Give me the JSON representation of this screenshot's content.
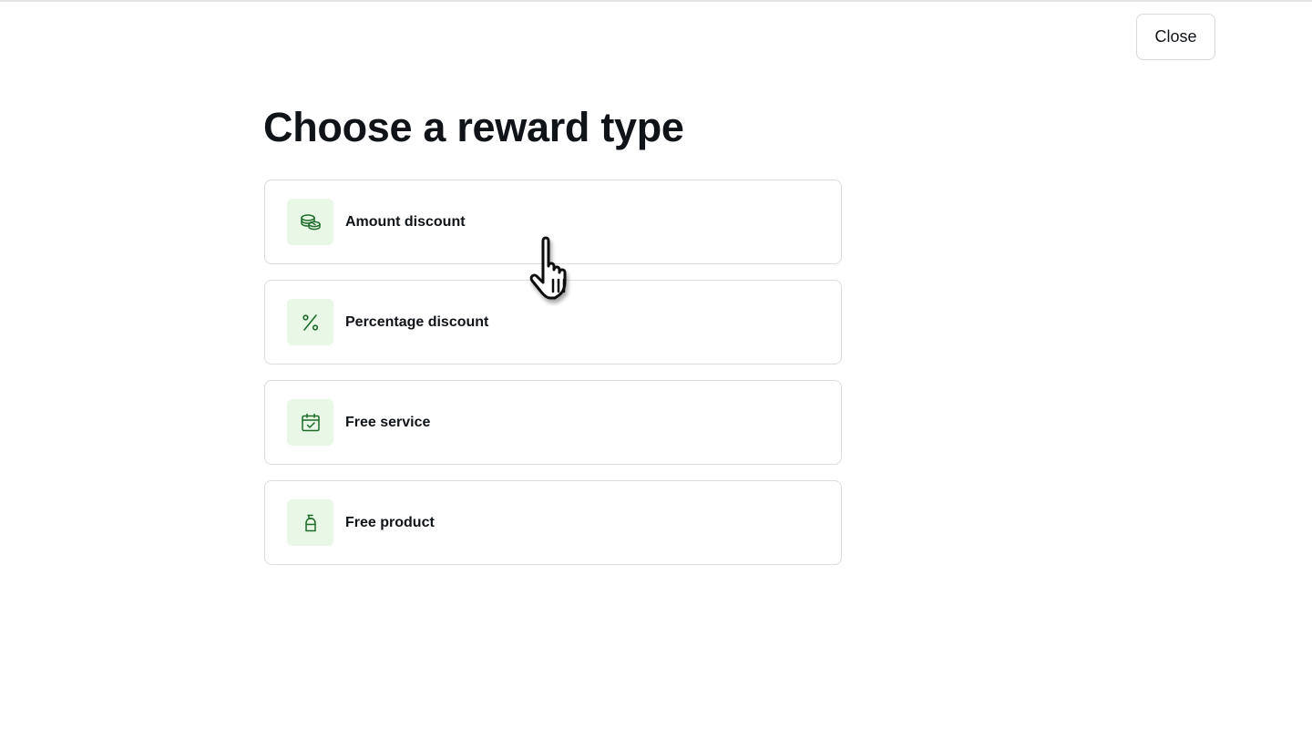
{
  "header": {
    "close_label": "Close"
  },
  "page": {
    "title": "Choose a reward type"
  },
  "colors": {
    "icon_tile_bg": "#e8f7e6",
    "icon_stroke": "#1e6b2a",
    "card_border": "#dcdcdc",
    "text": "#101418"
  },
  "options": [
    {
      "label": "Amount discount",
      "icon": "coins-icon"
    },
    {
      "label": "Percentage discount",
      "icon": "percent-icon"
    },
    {
      "label": "Free service",
      "icon": "calendar-check-icon"
    },
    {
      "label": "Free product",
      "icon": "product-bottle-icon"
    }
  ]
}
